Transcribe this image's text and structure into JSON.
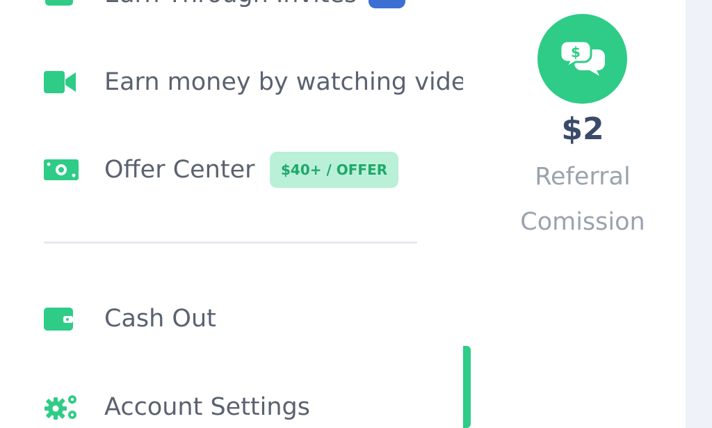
{
  "menu": {
    "items": [
      {
        "label": "Earn Through Invites",
        "icon": "invite-icon",
        "badge": "+"
      },
      {
        "label": "Earn money by watching videos",
        "icon": "video-camera-icon"
      },
      {
        "label": "Offer Center",
        "icon": "money-bill-icon",
        "badge": "$40+ / OFFER"
      },
      {
        "label": "Cash Out",
        "icon": "wallet-icon"
      },
      {
        "label": "Account Settings",
        "icon": "gears-icon"
      }
    ]
  },
  "stat": {
    "icon": "money-chat-icon",
    "value": "$2",
    "label": "Referral Comission"
  },
  "colors": {
    "accent": "#2ecc87",
    "badge_green_bg": "#baf0d8",
    "badge_green_text": "#1ea86a",
    "badge_blue_bg": "#3b6fd4",
    "text": "#5a6270",
    "stat_value": "#3b4a68",
    "stat_label": "#9aa3ad"
  }
}
